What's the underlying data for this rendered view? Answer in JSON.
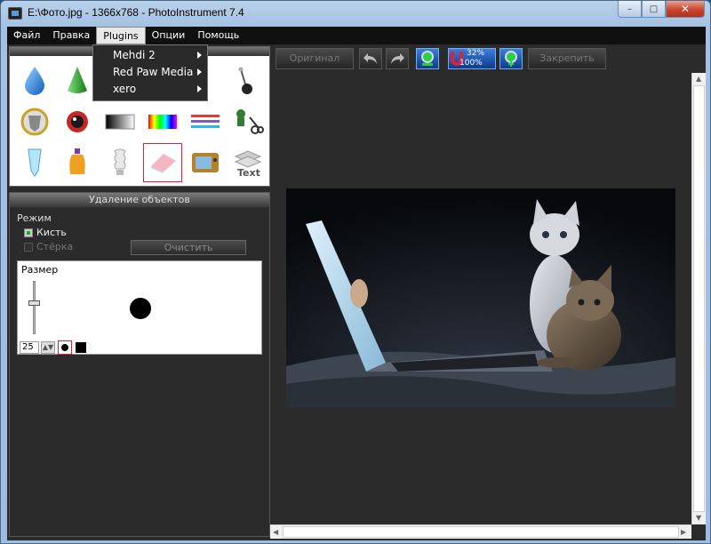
{
  "window": {
    "title": "E:\\Фото.jpg - 1366x768 - PhotoInstrument 7.4",
    "min_glyph": "–",
    "max_glyph": "□",
    "close_glyph": "✕"
  },
  "menu": {
    "items": [
      "Файл",
      "Правка",
      "Plugins",
      "Опции",
      "Помощь"
    ],
    "active": "Plugins"
  },
  "plugins_dropdown": {
    "items": [
      "Mehdi 2",
      "Red Paw Media",
      "xero"
    ]
  },
  "tools": {
    "items": [
      {
        "name": "drop-icon"
      },
      {
        "name": "cone-icon"
      },
      {
        "name": "blank-tool-icon"
      },
      {
        "name": "blank-tool-icon"
      },
      {
        "name": "stamp-pin-icon"
      },
      {
        "name": "shield-icon"
      },
      {
        "name": "lens-icon"
      },
      {
        "name": "gradient-icon"
      },
      {
        "name": "spectrum-icon"
      },
      {
        "name": "lines-icon"
      },
      {
        "name": "scissors-icon"
      },
      {
        "name": "tube-icon"
      },
      {
        "name": "bottle-icon"
      },
      {
        "name": "bulb-icon"
      },
      {
        "name": "eraser-icon"
      },
      {
        "name": "tv-icon"
      },
      {
        "name": "text-layers-icon"
      }
    ],
    "selected": "eraser-icon",
    "text_tool_label": "Text"
  },
  "removal_panel": {
    "title": "Удаление объектов",
    "mode_label": "Режим",
    "brush_label": "Кисть",
    "brush_checked": true,
    "eraser_label": "Стёрка",
    "eraser_checked": false,
    "clear_button": "Очистить",
    "size_label": "Размер",
    "size_value": "25",
    "spin_glyph": "▲▼",
    "brush_shape": "round"
  },
  "toolbar": {
    "original_button": "Оригинал",
    "undo_icon": "undo-arrow-icon",
    "redo_icon": "redo-arrow-icon",
    "zoom_fit_icon": "zoom-fit-icon",
    "zoom_top": "32%",
    "zoom_bottom": "100%",
    "zoom_in_icon": "zoom-in-icon",
    "pin_button": "Закрепить"
  },
  "canvas": {
    "image": "photo-laptop-cats"
  },
  "scroll": {
    "up": "▲",
    "down": "▼",
    "left": "◀",
    "right": "▶"
  }
}
